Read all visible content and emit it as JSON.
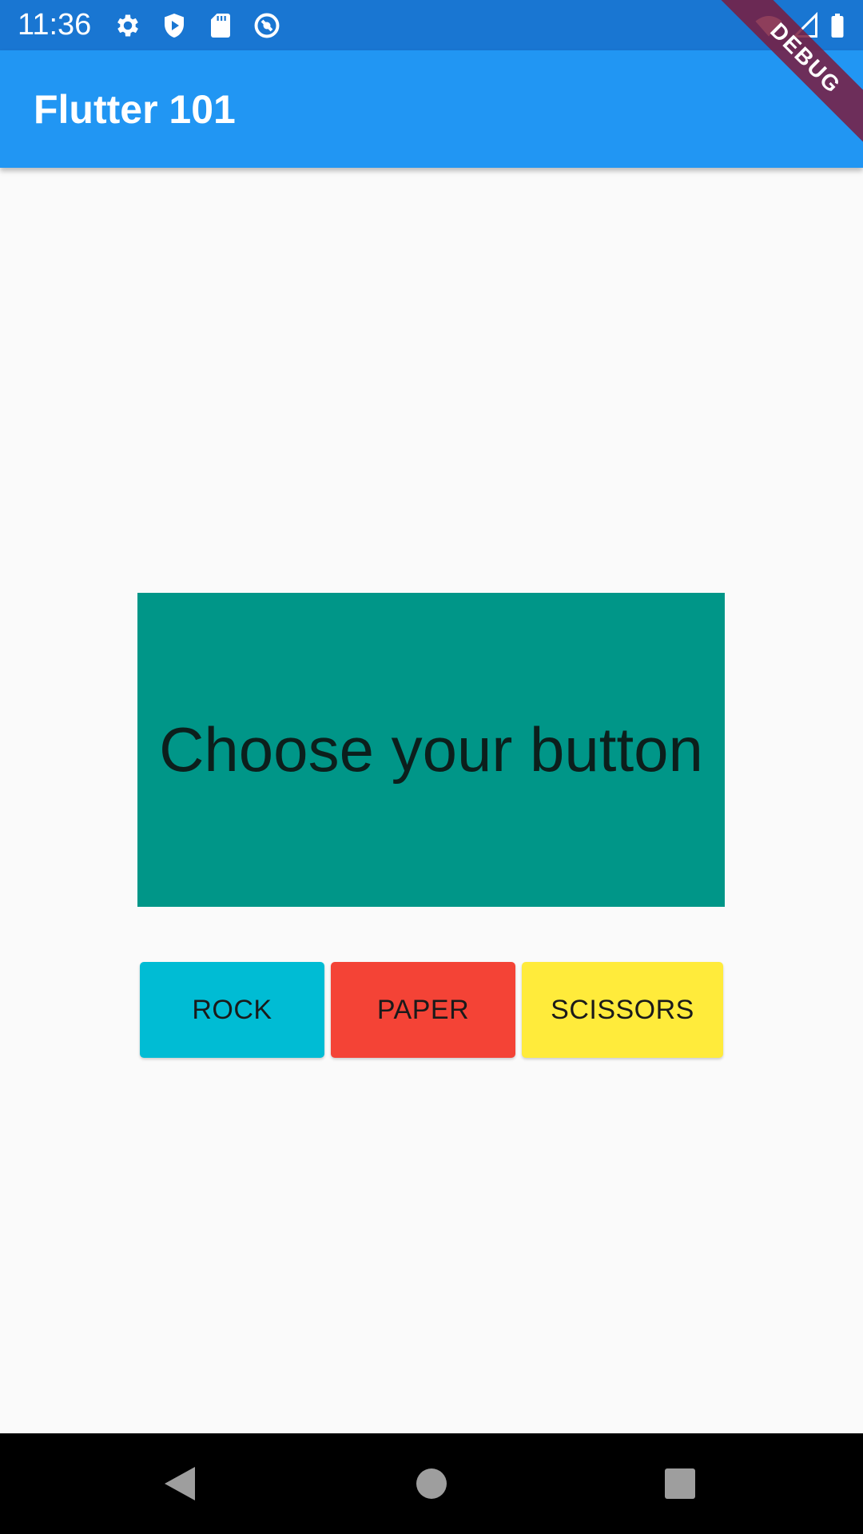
{
  "status_bar": {
    "time": "11:36",
    "icons": [
      "settings-icon",
      "shield-play-icon",
      "sd-card-icon",
      "sync-icon",
      "wifi-icon",
      "signal-icon",
      "battery-icon"
    ]
  },
  "app_bar": {
    "title": "Flutter 101"
  },
  "debug_banner": {
    "label": "DEBUG"
  },
  "main": {
    "result_text": "Choose your button",
    "buttons": [
      {
        "label": "ROCK",
        "color": "#00bcd4"
      },
      {
        "label": "PAPER",
        "color": "#f44336"
      },
      {
        "label": "SCISSORS",
        "color": "#ffeb3b"
      }
    ]
  },
  "nav_bar": {
    "icons": [
      "back-icon",
      "home-icon",
      "recents-icon"
    ]
  },
  "colors": {
    "status_bar": "#1976d2",
    "app_bar": "#2196f3",
    "result_box": "#009688",
    "background": "#fafafa"
  }
}
